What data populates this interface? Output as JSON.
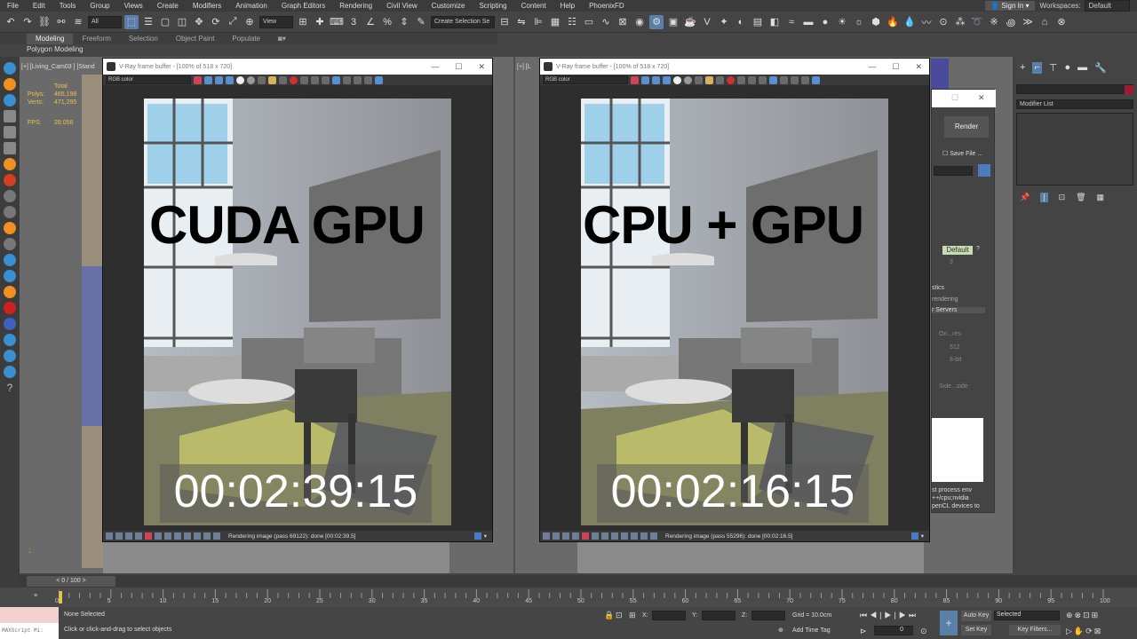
{
  "menu": [
    "File",
    "Edit",
    "Tools",
    "Group",
    "Views",
    "Create",
    "Modifiers",
    "Animation",
    "Graph Editors",
    "Rendering",
    "Civil View",
    "Customize",
    "Scripting",
    "Content",
    "Help",
    "PhoenixFD"
  ],
  "account": {
    "sign_in": "Sign In",
    "workspaces_label": "Workspaces:",
    "workspace": "Default"
  },
  "toolbar": {
    "filter": "All",
    "view": "View",
    "selection_set": "Create Selection Se"
  },
  "ribbon": {
    "tabs": [
      "Modeling",
      "Freeform",
      "Selection",
      "Object Paint",
      "Populate"
    ],
    "sub": "Polygon Modeling"
  },
  "viewport": {
    "label_left": "[+] [Living_Cam03 ] [Stand",
    "label_right": "[+] [L",
    "stats": {
      "total_label": "Total",
      "polys_label": "Polys:",
      "polys": "465,198",
      "verts_label": "Verts:",
      "verts": "471,295",
      "fps_label": "FPS:",
      "fps": "28.056"
    }
  },
  "vfb_left": {
    "title": "V-Ray frame buffer - [100% of 518 x 720]",
    "channel": "RGB color",
    "overlay": "CUDA GPU",
    "timer": "00:02:39:15",
    "status": "Rendering image (pass 69122): done [00:02:39.5]"
  },
  "vfb_right": {
    "title": "V-Ray frame buffer - [100% of 518 x 720]",
    "channel": "RGB color",
    "overlay": "CPU + GPU",
    "timer": "00:02:16:15",
    "status": "Rendering image (pass 55296): done [00:02:16.5]"
  },
  "render_setup": {
    "render": "Render",
    "save_file": "Save File",
    "default": "Default",
    "value3": "3",
    "stics": "stics",
    "rendering": "rendering",
    "servers": "r Servers",
    "on_res": "On...res",
    "size": "512",
    "bit": "8-bit",
    "side": "Side...side",
    "note1": "st process env",
    "note2": "++/cpu;nvidia",
    "note3": "penCL devices to"
  },
  "cmdpanel": {
    "modifier_list": "Modifier List"
  },
  "timeslider": {
    "frame": "0 / 100"
  },
  "trackbar": {
    "ticks": [
      "0",
      "5",
      "10",
      "15",
      "20",
      "25",
      "30",
      "35",
      "40",
      "45",
      "50",
      "55",
      "60",
      "65",
      "70",
      "75",
      "80",
      "85",
      "90",
      "95",
      "100"
    ]
  },
  "status": {
    "maxscript": "MAXScript Mi:",
    "none_selected": "None Selected",
    "prompt": "Click or click-and-drag to select objects",
    "x": "X:",
    "y": "Y:",
    "z": "Z:",
    "grid": "Grid = 10.0cm",
    "add_time_tag": "Add Time Tag",
    "auto_key": "Auto Key",
    "set_key": "Set Key",
    "selected": "Selected",
    "key_filters": "Key Filters...",
    "frame": "0"
  }
}
